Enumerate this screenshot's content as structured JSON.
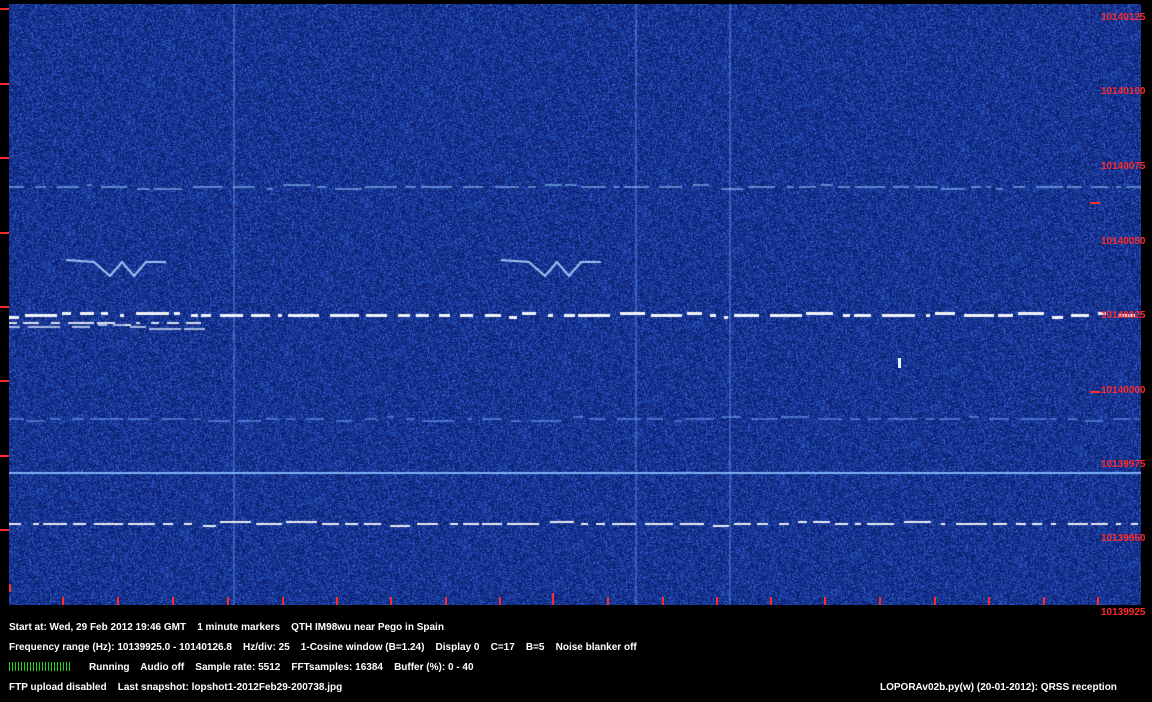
{
  "app": {
    "program": "LOPORAv02b.py(w) (20-01-2012): QRSS reception"
  },
  "colors": {
    "background": "#000000",
    "waterfall_base": "#0d2a8c",
    "trace": "#ffffff",
    "scale": "#ff2a2a",
    "text": "#ffffff",
    "level_meter": "#1fd31f"
  },
  "frequency_scale": {
    "labels": [
      "10140125",
      "10140100",
      "10140075",
      "10140050",
      "10140025",
      "10140000",
      "10139975",
      "10139950",
      "10139925"
    ]
  },
  "status": {
    "line1": "Start at: Wed, 29 Feb 2012 19:46 GMT    1 minute markers    QTH IM98wu near Pego in Spain",
    "line2": "Frequency range (Hz): 10139925.0 - 10140126.8    Hz/div: 25    1-Cosine window (B=1.24)    Display 0    C=17    B=5    Noise blanker off",
    "line3": "Running    Audio off    Sample rate: 5512    FFTsamples: 16384    Buffer (%): 0 - 40",
    "line4": "FTP upload disabled    Last snapshot: lopshot1-2012Feb29-200738.jpg"
  }
}
